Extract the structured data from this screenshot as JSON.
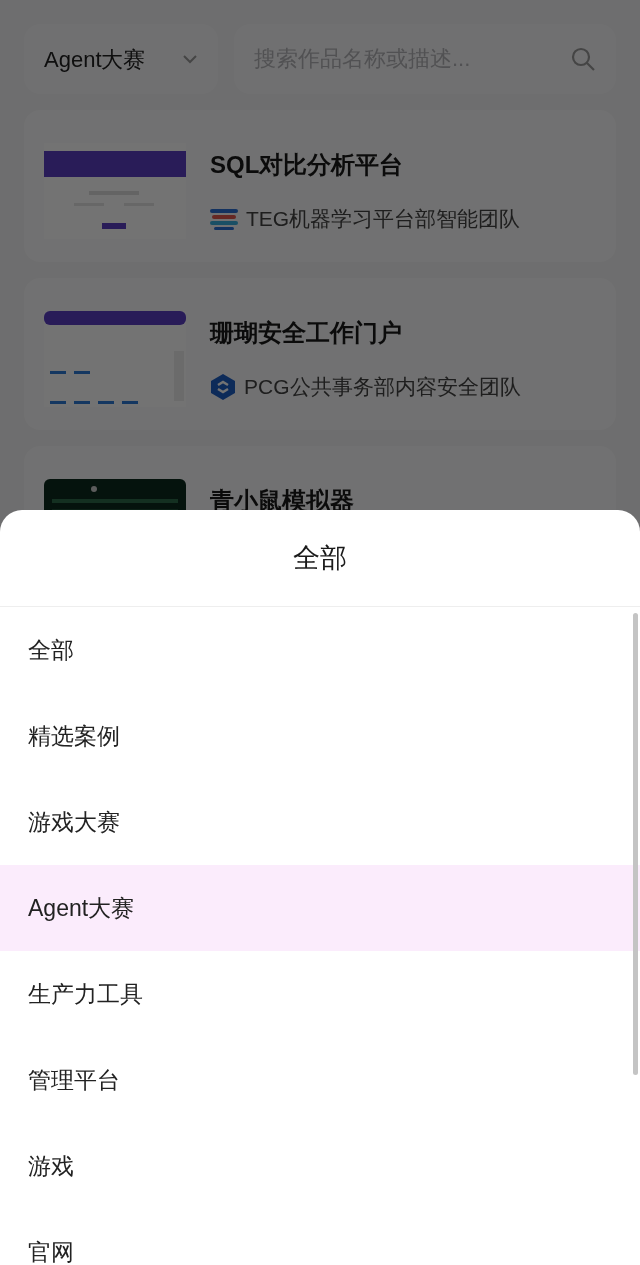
{
  "filter_bar": {
    "category": "Agent大赛",
    "search": {
      "placeholder": "搜索作品名称或描述..."
    }
  },
  "cards": [
    {
      "title": "SQL对比分析平台",
      "team": "TEG机器学习平台部智能团队",
      "thumbnail": {
        "kind": "purple"
      },
      "logo": {
        "kind": "stripes"
      }
    },
    {
      "title": "珊瑚安全工作门户",
      "team": "PCG公共事务部内容安全团队",
      "thumbnail": {
        "kind": "dashboard"
      },
      "logo": {
        "kind": "hex"
      }
    },
    {
      "title": "青小鼠模拟器",
      "thumbnail": {
        "kind": "dark"
      }
    }
  ],
  "sheet": {
    "title": "全部",
    "items": [
      {
        "label": "全部",
        "selected": false
      },
      {
        "label": "精选案例",
        "selected": false
      },
      {
        "label": "游戏大赛",
        "selected": false
      },
      {
        "label": "Agent大赛",
        "selected": true
      },
      {
        "label": "生产力工具",
        "selected": false
      },
      {
        "label": "管理平台",
        "selected": false
      },
      {
        "label": "游戏",
        "selected": false
      },
      {
        "label": "官网",
        "selected": false
      }
    ]
  }
}
